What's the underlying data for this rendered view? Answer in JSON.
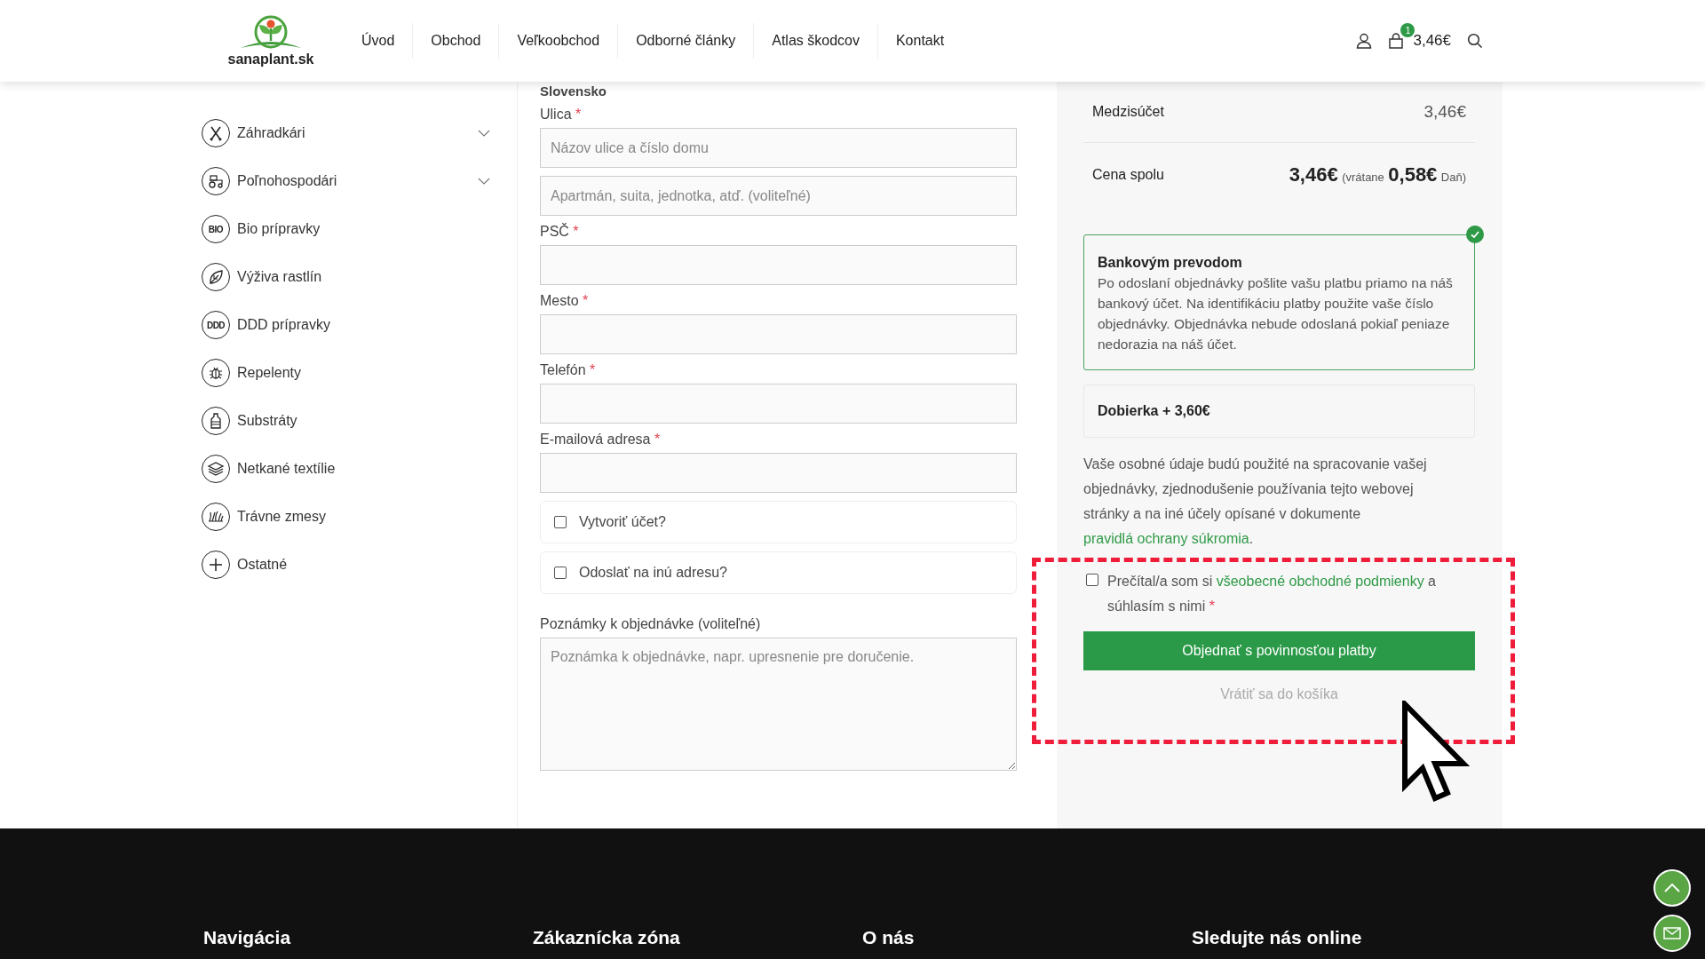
{
  "header": {
    "logo_text": "sanaplant.sk",
    "nav": [
      "Úvod",
      "Obchod",
      "Veľkoobchod",
      "Odborné články",
      "Atlas škodcov",
      "Kontakt"
    ],
    "cart": {
      "count": "1",
      "total": "3,46€"
    }
  },
  "sidebar": {
    "items": [
      {
        "label": "Záhradkári",
        "kind": "tools",
        "expandable": true
      },
      {
        "label": "Poľnohospodári",
        "kind": "tractor",
        "expandable": true
      },
      {
        "label": "Bio prípravky",
        "kind": "badge",
        "badge_text": "BIO",
        "expandable": false
      },
      {
        "label": "Výživa rastlín",
        "kind": "leaf",
        "expandable": false
      },
      {
        "label": "DDD prípravky",
        "kind": "badge",
        "badge_text": "DDD",
        "expandable": false
      },
      {
        "label": "Repelenty",
        "kind": "bug",
        "expandable": false
      },
      {
        "label": "Substráty",
        "kind": "bottle",
        "expandable": false
      },
      {
        "label": "Netkané textílie",
        "kind": "layers",
        "expandable": false
      },
      {
        "label": "Trávne zmesy",
        "kind": "grass",
        "expandable": false
      },
      {
        "label": "Ostatné",
        "kind": "plus",
        "expandable": false
      }
    ]
  },
  "form": {
    "country": "Slovensko",
    "fields": [
      {
        "kind": "input",
        "label": "Ulica",
        "mark": "*",
        "placeholder": "Názov ulice a číslo domu"
      },
      {
        "kind": "input",
        "placeholder": "Apartmán, suita, jednotka, atď. (voliteľné)"
      },
      {
        "kind": "input",
        "label": "PSČ",
        "mark": "*"
      },
      {
        "kind": "input",
        "label": "Mesto",
        "mark": "*"
      },
      {
        "kind": "input",
        "label": "Telefón",
        "mark": "*"
      },
      {
        "kind": "input",
        "label": "E-mailová adresa",
        "mark": "*"
      }
    ],
    "options": [
      {
        "label": "Vytvoriť účet?",
        "checked": false
      },
      {
        "label": "Odoslať na inú adresu?",
        "checked": false
      }
    ],
    "notes": {
      "label": "Poznámky k objednávke (voliteľné)",
      "placeholder": "Poznámka k objednávke, napr. upresnenie pre doručenie."
    }
  },
  "summary": {
    "subtotal_label": "Medzisúčet",
    "subtotal": "3,46€",
    "total_label": "Cena spolu",
    "total": "3,46€",
    "tax_prefix": "(vrátane",
    "tax": "0,58€",
    "tax_suffix": "Daň)"
  },
  "payment_methods": [
    {
      "title": "Bankovým prevodom",
      "description": "Po odoslaní objednávky pošlite vašu platbu priamo na náš bankový účet. Na identifikáciu platby použite vaše číslo objednávky. Objednávka nebude odoslaná pokiaľ peniaze nedorazia na náš účet.",
      "selected": true
    },
    {
      "title": "Dobierka + 3,60€",
      "selected": false
    }
  ],
  "privacy": {
    "text": "Vaše osobné údaje budú použité na spracovanie vašej objednávky, zjednodušenie používania tejto webovej stránky a na iné účely opísané v dokumente",
    "link": "pravidlá ochrany súkromia",
    "end": "."
  },
  "terms": {
    "checked": false,
    "before": "Prečítal/a som si",
    "link": "všeobecné obchodné podmienky",
    "after": "a súhlasím s nimi",
    "mark": "*"
  },
  "order_button": "Objednať s povinnosťou platby",
  "back_link": "Vrátiť sa do košíka",
  "footer": {
    "headings": [
      "Navigácia",
      "Zákaznícka zóna",
      "O nás",
      "Sledujte nás online"
    ]
  }
}
